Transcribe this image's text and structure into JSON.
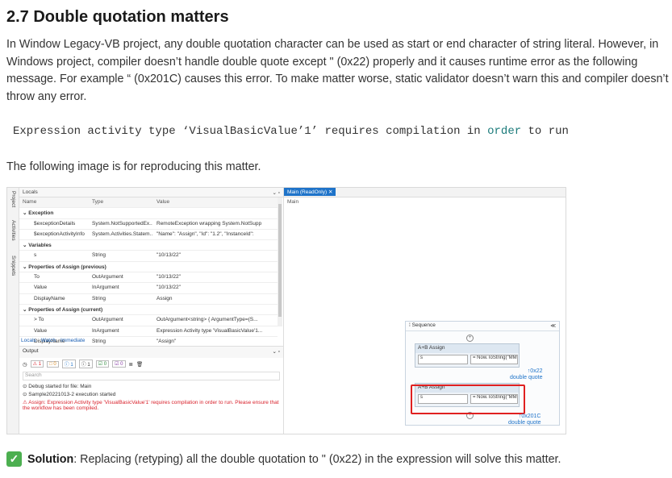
{
  "heading": "2.7 Double quotation matters",
  "paragraph": "In Window Legacy-VB project, any double quotation character can be used as start or end character of string literal. However, in Windows project, compiler doesn’t handle double quote except \" (0x22) properly and it causes runtime error as the following message. For example “ (0x201C) causes this error. To make matter worse, static validator doesn’t warn this and compiler doesn’t throw any error.",
  "code": {
    "part1": "Expression activity type ‘VisualBasicValue’1’ requires compilation in ",
    "keyword1": "order",
    "part2": " to run"
  },
  "paragraph2": "The following image is for reproducing this matter.",
  "solution": {
    "icon": "check-icon",
    "label": "Solution",
    "text": " : Replacing (retyping) all the double quotation to \" (0x22) in the expression will solve this matter."
  },
  "screenshot": {
    "vertical_tabs": [
      "Project",
      "Activities",
      "Snippets"
    ],
    "locals_title": "Locals",
    "columns": [
      "Name",
      "Type",
      "Value"
    ],
    "rows": [
      {
        "kind": "group",
        "name": "Exception"
      },
      {
        "kind": "item",
        "name": "$exceptionDetails",
        "type": "System.NotSupportedEx...",
        "value": "RemoteException wrapping System.NotSupp"
      },
      {
        "kind": "item",
        "name": "$exceptionActivityInfo",
        "type": "System.Activities.Statem...",
        "value": "\"Name\": \"Assign\", \"Id\": \"1.2\", \"InstanceId\":"
      },
      {
        "kind": "group",
        "name": "Variables"
      },
      {
        "kind": "item",
        "name": "s",
        "type": "String",
        "value": "\"10/13/22\""
      },
      {
        "kind": "group",
        "name": "Properties of Assign (previous)"
      },
      {
        "kind": "item",
        "name": "To",
        "type": "OutArgument",
        "value": "\"10/13/22\""
      },
      {
        "kind": "item",
        "name": "Value",
        "type": "InArgument",
        "value": "\"10/13/22\""
      },
      {
        "kind": "item",
        "name": "DisplayName",
        "type": "String",
        "value": "Assign"
      },
      {
        "kind": "group",
        "name": "Properties of Assign (current)"
      },
      {
        "kind": "item",
        "name": "> To",
        "type": "OutArgument",
        "value": "OutArgument<string> { ArgumentType=(S..."
      },
      {
        "kind": "item",
        "name": "Value",
        "type": "InArgument",
        "value": "Expression Activity type 'VisualBasicValue'1..."
      },
      {
        "kind": "item",
        "name": "DisplayName",
        "type": "String",
        "value": "\"Assign\""
      }
    ],
    "bottom_tabs": [
      "Locals",
      "Watch",
      "Immediate"
    ],
    "output_title": "Output",
    "output_badges": [
      "1",
      "0",
      "1",
      "1",
      "0",
      "0"
    ],
    "search_placeholder": "Search",
    "output_lines": [
      "Debug started for file: Main",
      "Sample20221013-2 execution started",
      "Assign: Expression Activity type 'VisualBasicValue'1' requires compilation in order to run.  Please ensure that the workflow has been compiled."
    ],
    "doc_tab": "Main (ReadOnly)",
    "breadcrumb": "Main",
    "sequence_label": "Sequence",
    "assign_label": "Assign",
    "var_s": "s",
    "expr": "= Now.ToString(\"MM",
    "ann1_code": "0x22",
    "ann1_text": "double quote",
    "ann2_code": "0x201C",
    "ann2_text": "double quote"
  }
}
